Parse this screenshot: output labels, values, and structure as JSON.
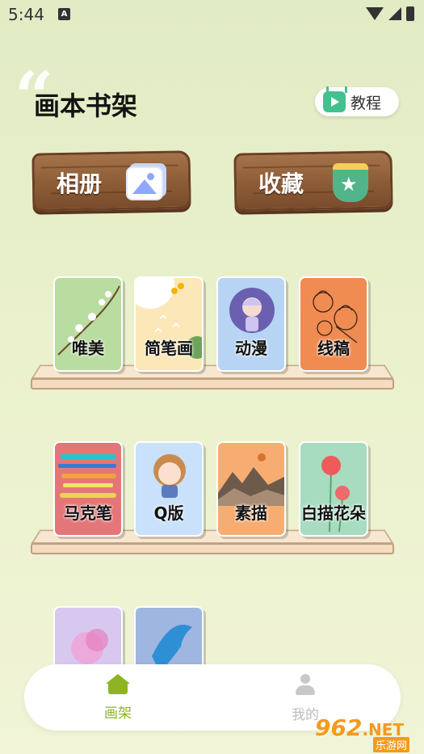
{
  "status_bar": {
    "time": "5:44",
    "notification_glyph": "A"
  },
  "header": {
    "title": "画本书架",
    "tutorial_label": "教程"
  },
  "signs": [
    {
      "label": "相册",
      "icon": "album-icon"
    },
    {
      "label": "收藏",
      "icon": "favorites-icon"
    }
  ],
  "shelves": [
    {
      "books": [
        "唯美",
        "简笔画",
        "动漫",
        "线稿"
      ]
    },
    {
      "books": [
        "马克笔",
        "Q版",
        "素描",
        "白描花朵"
      ]
    },
    {
      "books": [
        "",
        ""
      ]
    }
  ],
  "bottom_nav": {
    "items": [
      {
        "label": "画架",
        "active": true,
        "color": "#8eb423"
      },
      {
        "label": "我的",
        "active": false,
        "color": "#bdbdbd"
      }
    ]
  },
  "watermark": {
    "number": "962",
    "suffix": ".NET",
    "sub": "乐游网"
  }
}
